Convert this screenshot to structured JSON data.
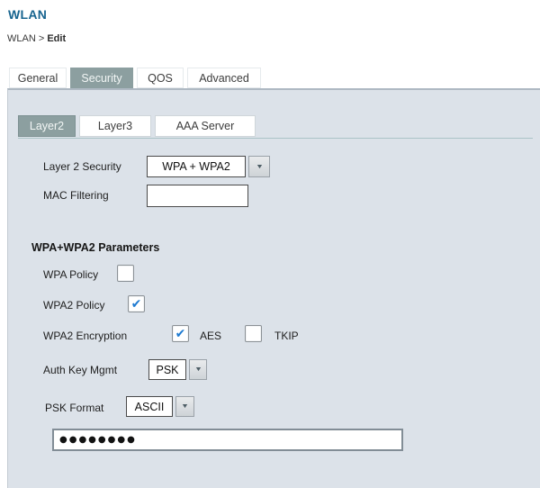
{
  "header": {
    "title": "WLAN",
    "breadcrumb_prefix": "WLAN > ",
    "breadcrumb_current": "Edit"
  },
  "tabs": [
    {
      "label": "General",
      "selected": false
    },
    {
      "label": "Security",
      "selected": true
    },
    {
      "label": "QOS",
      "selected": false
    },
    {
      "label": "Advanced",
      "selected": false
    }
  ],
  "subtabs": [
    {
      "label": "Layer2",
      "selected": true
    },
    {
      "label": "Layer3",
      "selected": false
    },
    {
      "label": "AAA Server",
      "selected": false
    }
  ],
  "form": {
    "layer2_security": {
      "label": "Layer 2 Security",
      "value": "WPA + WPA2"
    },
    "mac_filtering": {
      "label": "MAC Filtering",
      "value": ""
    },
    "section_title": "WPA+WPA2 Parameters",
    "wpa_policy": {
      "label": "WPA Policy",
      "checked": false
    },
    "wpa2_policy": {
      "label": "WPA2 Policy",
      "checked": true
    },
    "wpa2_encryption": {
      "label": "WPA2 Encryption",
      "aes": {
        "label": "AES",
        "checked": true
      },
      "tkip": {
        "label": "TKIP",
        "checked": false
      }
    },
    "auth_key_mgmt": {
      "label": "Auth Key Mgmt",
      "value": "PSK"
    },
    "psk_format": {
      "label": "PSK Format",
      "value": "ASCII"
    },
    "psk": {
      "value": "●●●●●●●●"
    }
  },
  "icons": {
    "check": "✔",
    "dropdown_arrow": "▼"
  },
  "colors": {
    "selected_tab": "#8c9fa0",
    "title_blue": "#17648f",
    "check_blue": "#1e7ad1",
    "panel_bg": "#dce2e9",
    "divider_teal": "#aac3c7"
  }
}
